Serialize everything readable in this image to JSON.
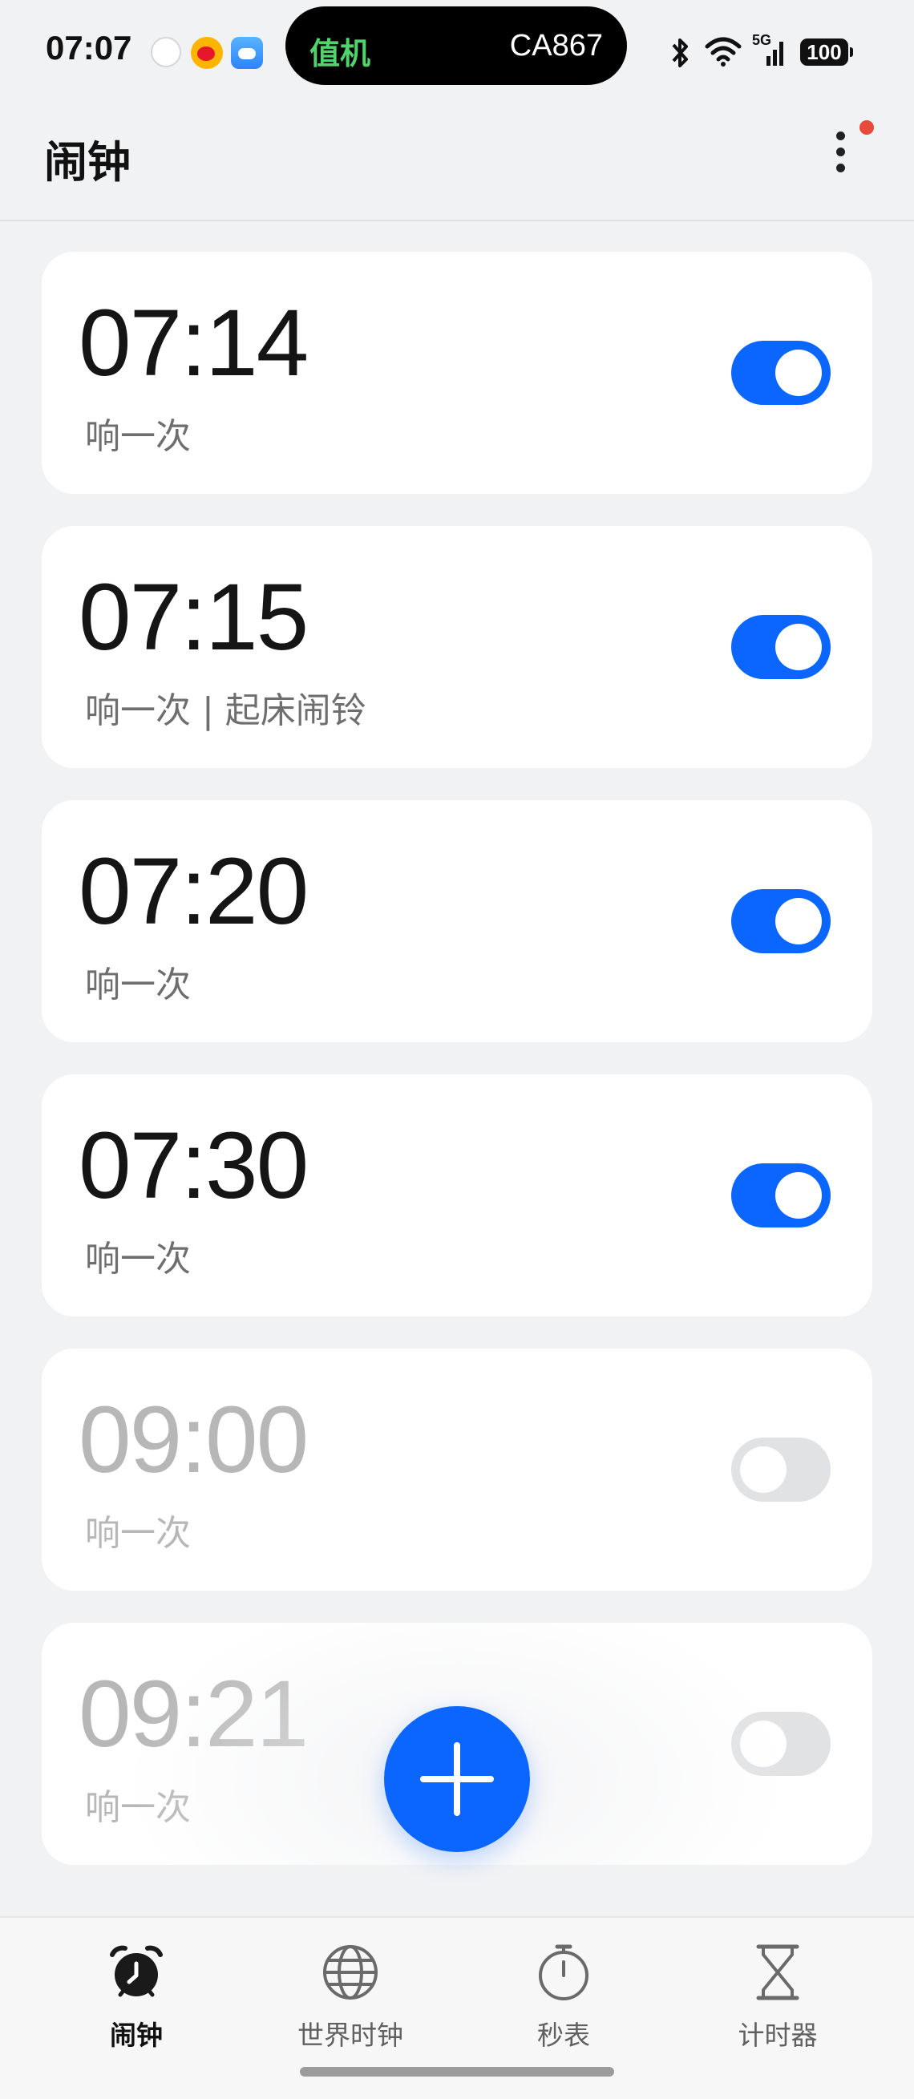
{
  "status_bar": {
    "time": "07:07",
    "island_left": "值机",
    "island_right": "CA867",
    "network": "5G",
    "battery": "100",
    "notification_icons": [
      "clock-icon",
      "weibo-icon",
      "weather-icon"
    ]
  },
  "app_bar": {
    "title": "闹钟",
    "more_icon": "more-vertical-icon",
    "badge_color": "#e84a3c"
  },
  "alarms": [
    {
      "time": "07:14",
      "label": "响一次",
      "enabled": true
    },
    {
      "time": "07:15",
      "label": "响一次 | 起床闹铃",
      "enabled": true
    },
    {
      "time": "07:20",
      "label": "响一次",
      "enabled": true
    },
    {
      "time": "07:30",
      "label": "响一次",
      "enabled": true
    },
    {
      "time": "09:00",
      "label": "响一次",
      "enabled": false
    },
    {
      "time": "09:21",
      "label": "响一次",
      "enabled": false
    }
  ],
  "fab": {
    "icon": "plus-icon",
    "color": "#0a66ff"
  },
  "bottom_nav": {
    "items": [
      {
        "label": "闹钟",
        "icon": "alarm-clock-icon",
        "active": true
      },
      {
        "label": "世界时钟",
        "icon": "globe-icon",
        "active": false
      },
      {
        "label": "秒表",
        "icon": "stopwatch-icon",
        "active": false
      },
      {
        "label": "计时器",
        "icon": "hourglass-icon",
        "active": false
      }
    ]
  },
  "colors": {
    "accent": "#0a66ff",
    "background": "#f1f2f4",
    "card": "#ffffff",
    "disabled_text": "#b7b7b7"
  }
}
